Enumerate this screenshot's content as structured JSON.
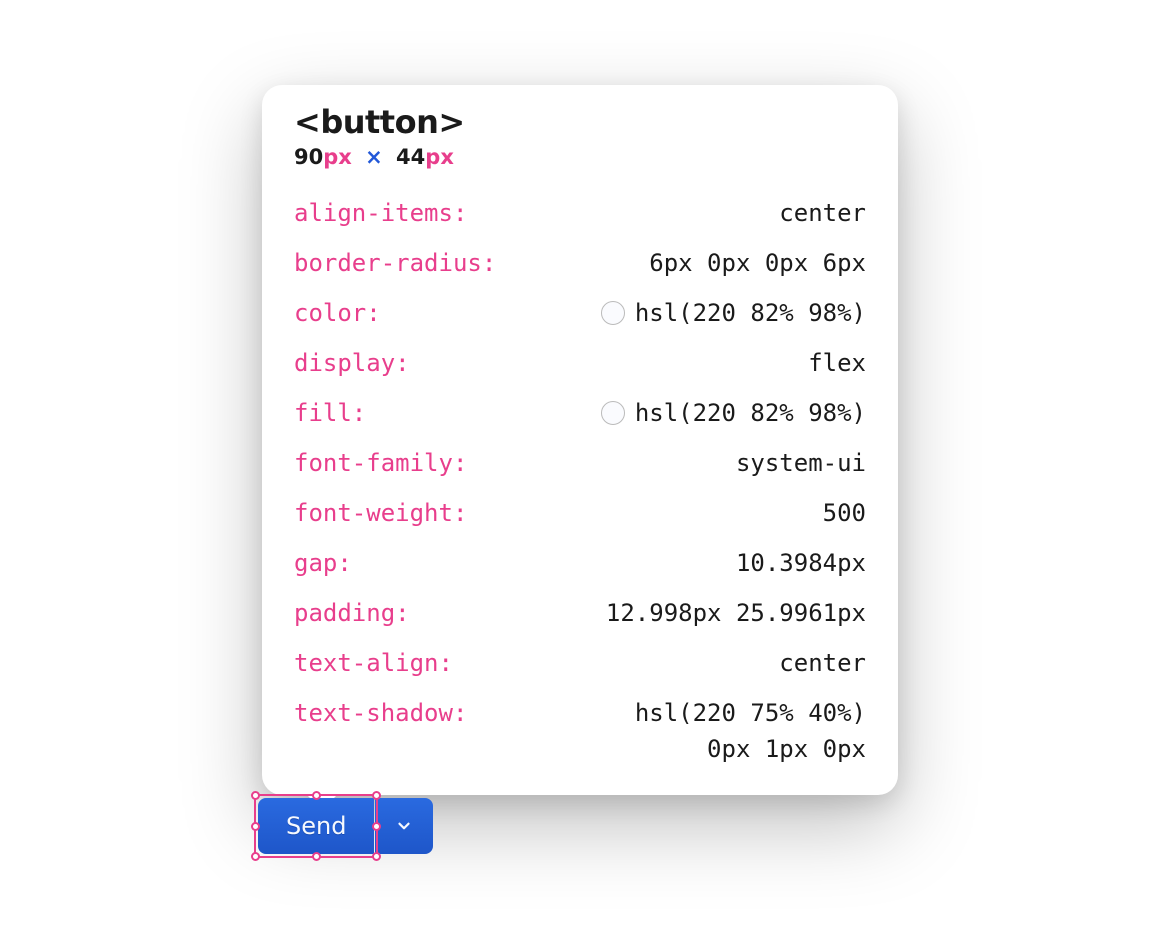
{
  "tooltip": {
    "tag": "<button>",
    "dimensions": {
      "width_num": "90",
      "width_unit": "px",
      "sep": "×",
      "height_num": "44",
      "height_unit": "px"
    },
    "props": [
      {
        "name": "align-items",
        "value": "center",
        "swatch": false
      },
      {
        "name": "border-radius",
        "value": "6px 0px 0px 6px",
        "swatch": false
      },
      {
        "name": "color",
        "value": "hsl(220 82% 98%)",
        "swatch": true
      },
      {
        "name": "display",
        "value": "flex",
        "swatch": false
      },
      {
        "name": "fill",
        "value": "hsl(220 82% 98%)",
        "swatch": true
      },
      {
        "name": "font-family",
        "value": "system-ui",
        "swatch": false
      },
      {
        "name": "font-weight",
        "value": "500",
        "swatch": false
      },
      {
        "name": "gap",
        "value": "10.3984px",
        "swatch": false
      },
      {
        "name": "padding",
        "value": "12.998px 25.9961px",
        "swatch": false
      },
      {
        "name": "text-align",
        "value": "center",
        "swatch": false
      },
      {
        "name": "text-shadow",
        "value_line1": "hsl(220 75% 40%)",
        "value_line2": "0px 1px 0px",
        "multiline": true,
        "swatch": false
      }
    ]
  },
  "buttons": {
    "send_label": "Send"
  }
}
